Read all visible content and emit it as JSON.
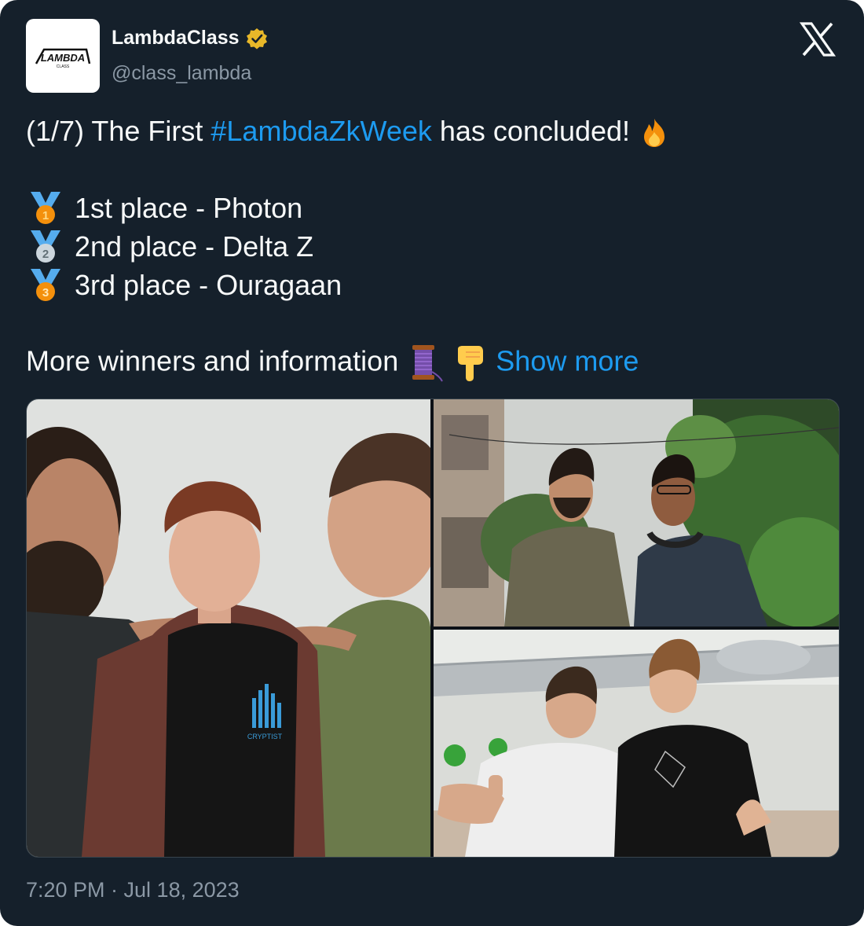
{
  "author": {
    "display_name": "LambdaClass",
    "handle": "@class_lambda",
    "verified": true,
    "avatar_logo_text": "LAMBDA",
    "avatar_logo_subtext": "CLASS"
  },
  "tweet": {
    "intro_prefix": "(1/7) The First ",
    "hashtag": "#LambdaZkWeek",
    "intro_suffix": " has concluded!",
    "places": [
      {
        "medal": "1",
        "text": "1st place - Photon"
      },
      {
        "medal": "2",
        "text": "2nd place - Delta Z"
      },
      {
        "medal": "3",
        "text": "3rd place - Ouragaan"
      }
    ],
    "more_text": "More winners and information",
    "show_more": "Show more"
  },
  "media": {
    "photos": [
      "photo-team-photon",
      "photo-team-delta-z",
      "photo-team-ouragaan"
    ],
    "shirt_logo_text": "CRYPTIST"
  },
  "timestamp": "7:20 PM · Jul 18, 2023",
  "icons": {
    "x_logo": "x-logo-icon",
    "verified": "verified-badge-icon",
    "fire": "fire-emoji-icon",
    "thread": "thread-spool-emoji-icon",
    "pointing_down": "backhand-index-pointing-down-icon"
  },
  "colors": {
    "background": "#15202b",
    "text": "#f7f9f9",
    "secondary": "#8b98a5",
    "link": "#1d9bf0",
    "verified_gold": "#e8b829"
  }
}
